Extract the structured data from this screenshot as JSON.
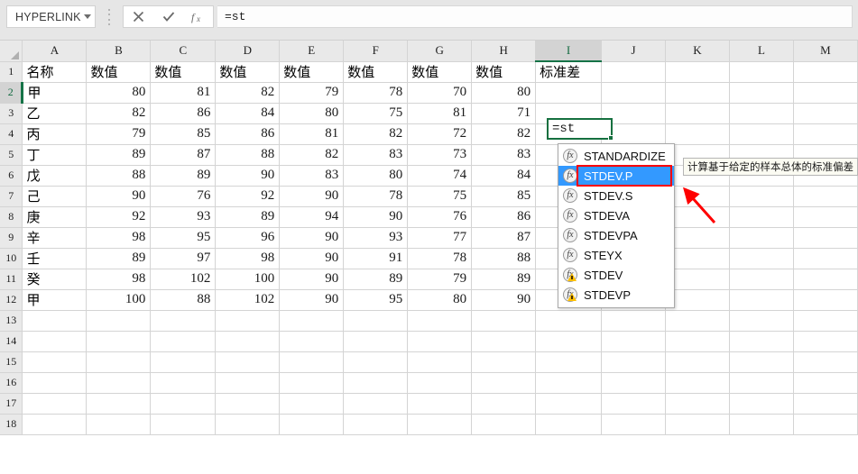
{
  "formula_bar": {
    "name_box_value": "HYPERLINK",
    "name_box_dropdown_icon": "chevron-down-icon",
    "cancel_icon": "close-icon",
    "confirm_icon": "check-icon",
    "function_icon": "fx-icon",
    "formula_value": "=st"
  },
  "grid": {
    "columns": [
      "A",
      "B",
      "C",
      "D",
      "E",
      "F",
      "G",
      "H",
      "I",
      "J",
      "K",
      "L",
      "M"
    ],
    "active_column": "I",
    "active_row": 2,
    "row_numbers": [
      1,
      2,
      3,
      4,
      5,
      6,
      7,
      8,
      9,
      10,
      11,
      12,
      13,
      14,
      15,
      16,
      17,
      18
    ],
    "headers": [
      "名称",
      "数值",
      "数值",
      "数值",
      "数值",
      "数值",
      "数值",
      "数值",
      "标准差"
    ],
    "rows": [
      {
        "name": "甲",
        "values": [
          80,
          81,
          82,
          79,
          78,
          70,
          80
        ]
      },
      {
        "name": "乙",
        "values": [
          82,
          86,
          84,
          80,
          75,
          81,
          71
        ]
      },
      {
        "name": "丙",
        "values": [
          79,
          85,
          86,
          81,
          82,
          72,
          82
        ]
      },
      {
        "name": "丁",
        "values": [
          89,
          87,
          88,
          82,
          83,
          73,
          83
        ]
      },
      {
        "name": "戊",
        "values": [
          88,
          89,
          90,
          83,
          80,
          74,
          84
        ]
      },
      {
        "name": "己",
        "values": [
          90,
          76,
          92,
          90,
          78,
          75,
          85
        ]
      },
      {
        "name": "庚",
        "values": [
          92,
          93,
          89,
          94,
          90,
          76,
          86
        ]
      },
      {
        "name": "辛",
        "values": [
          98,
          95,
          96,
          90,
          93,
          77,
          87
        ]
      },
      {
        "name": "壬",
        "values": [
          89,
          97,
          98,
          90,
          91,
          78,
          88
        ]
      },
      {
        "name": "癸",
        "values": [
          98,
          102,
          100,
          90,
          89,
          79,
          89
        ]
      },
      {
        "name": "甲",
        "values": [
          100,
          88,
          102,
          90,
          95,
          80,
          90
        ]
      }
    ]
  },
  "active_cell": {
    "reference": "I2",
    "content": "=st"
  },
  "autocomplete": {
    "items": [
      {
        "label": "STANDARDIZE",
        "icon": "fx-icon",
        "selected": false
      },
      {
        "label": "STDEV.P",
        "icon": "fx-icon",
        "selected": true
      },
      {
        "label": "STDEV.S",
        "icon": "fx-icon",
        "selected": false
      },
      {
        "label": "STDEVA",
        "icon": "fx-icon",
        "selected": false
      },
      {
        "label": "STDEVPA",
        "icon": "fx-icon",
        "selected": false
      },
      {
        "label": "STEYX",
        "icon": "fx-icon",
        "selected": false
      },
      {
        "label": "STDEV",
        "icon": "fx-warning-icon",
        "selected": false
      },
      {
        "label": "STDEVP",
        "icon": "fx-warning-icon",
        "selected": false
      }
    ],
    "tooltip": "计算基于给定的样本总体的标准偏差"
  },
  "annotation": {
    "highlight_color": "#ff0000",
    "arrow_color": "#ff0000",
    "selection_color": "#3399ff",
    "selection_border_color": "#15703f"
  }
}
